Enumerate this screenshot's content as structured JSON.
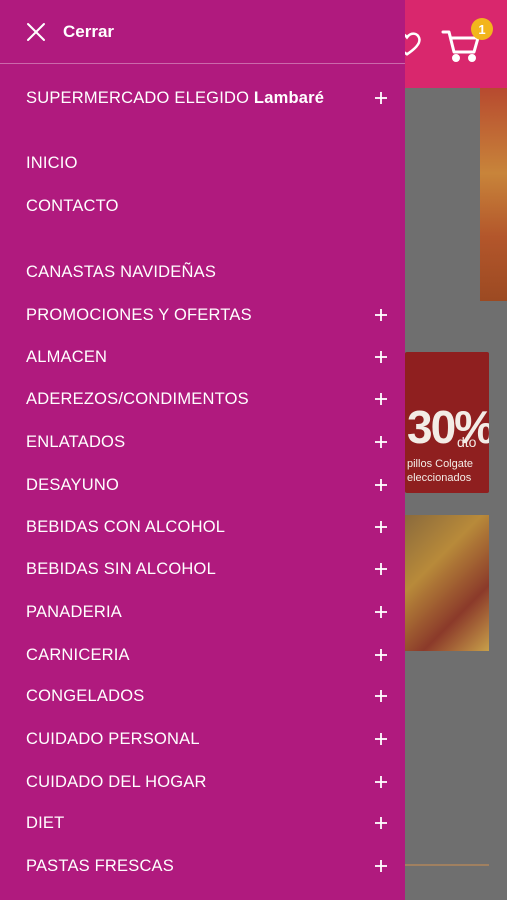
{
  "background": {
    "cart_count": "1",
    "banner_percent": "30%",
    "banner_dto": "dto",
    "banner_line1": "pillos Colgate",
    "banner_line2": "eleccionados"
  },
  "drawer": {
    "close_label": "Cerrar",
    "store_prefix": "SUPERMERCADO ELEGIDO ",
    "store_name": "Lambaré",
    "items": [
      {
        "label": "INICIO",
        "expandable": false
      },
      {
        "label": "CONTACTO",
        "expandable": false
      },
      {
        "label": "CANASTAS NAVIDEÑAS",
        "expandable": false
      },
      {
        "label": "PROMOCIONES Y OFERTAS",
        "expandable": true
      },
      {
        "label": "ALMACEN",
        "expandable": true
      },
      {
        "label": "ADEREZOS/CONDIMENTOS",
        "expandable": true
      },
      {
        "label": "ENLATADOS",
        "expandable": true
      },
      {
        "label": "DESAYUNO",
        "expandable": true
      },
      {
        "label": "BEBIDAS CON ALCOHOL",
        "expandable": true
      },
      {
        "label": "BEBIDAS SIN ALCOHOL",
        "expandable": true
      },
      {
        "label": "PANADERIA",
        "expandable": true
      },
      {
        "label": "CARNICERIA",
        "expandable": true
      },
      {
        "label": "CONGELADOS",
        "expandable": true
      },
      {
        "label": "CUIDADO PERSONAL",
        "expandable": true
      },
      {
        "label": "CUIDADO DEL HOGAR",
        "expandable": true
      },
      {
        "label": "DIET",
        "expandable": true
      },
      {
        "label": "PASTAS FRESCAS",
        "expandable": true
      }
    ]
  },
  "colors": {
    "drawer_bg": "#b01a7e",
    "header_bg": "#d9276d",
    "badge": "#f2b51c"
  }
}
